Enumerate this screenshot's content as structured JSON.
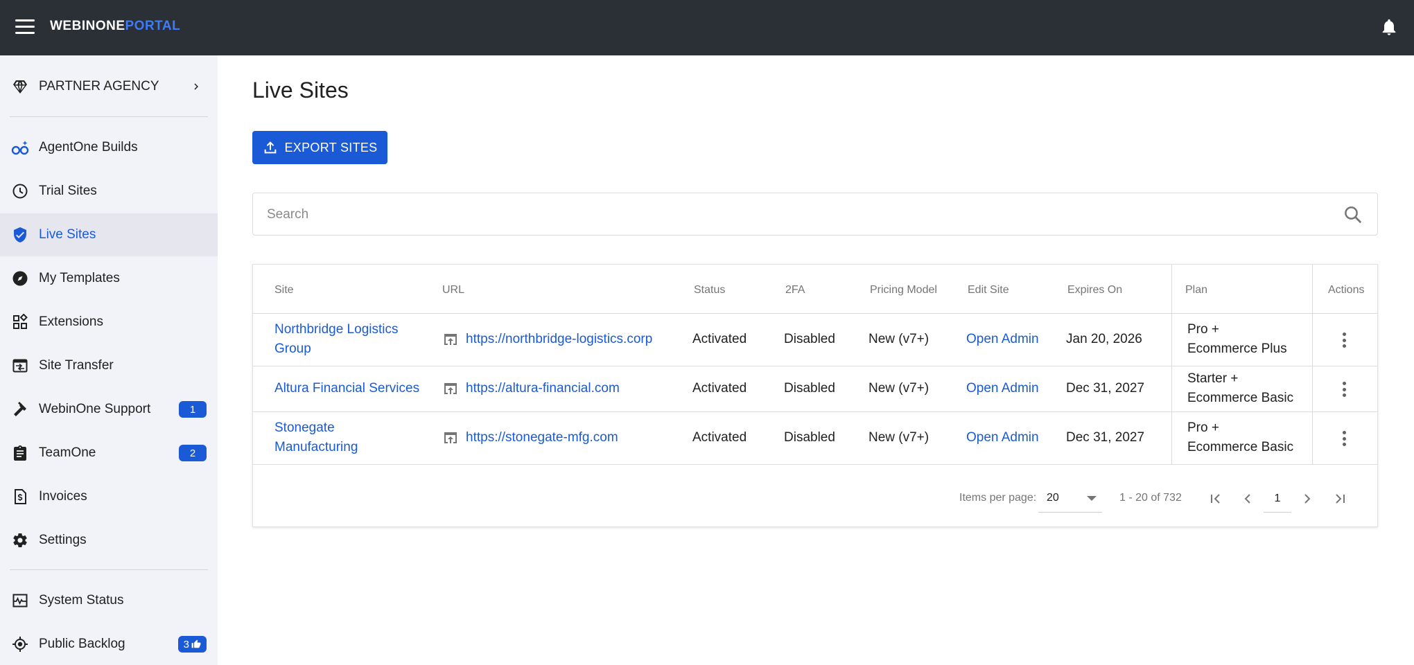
{
  "header": {
    "logo_part1": "WEBINONE",
    "logo_part2": "PORTAL",
    "bg_color": "#2b2f36",
    "accent_color": "#3e7bf6"
  },
  "sidebar": {
    "agency": "PARTNER AGENCY",
    "items": [
      {
        "label": "AgentOne Builds",
        "icon": "glasses-sparkle-icon"
      },
      {
        "label": "Trial Sites",
        "icon": "clock-icon"
      },
      {
        "label": "Live Sites",
        "icon": "shield-check-icon",
        "active": true
      },
      {
        "label": "My Templates",
        "icon": "compass-icon"
      },
      {
        "label": "Extensions",
        "icon": "extensions-icon"
      },
      {
        "label": "Site Transfer",
        "icon": "transfer-icon"
      },
      {
        "label": "WebinOne Support",
        "icon": "hammer-icon",
        "badge": "1"
      },
      {
        "label": "TeamOne",
        "icon": "clipboard-icon",
        "badge": "2"
      },
      {
        "label": "Invoices",
        "icon": "invoice-icon"
      },
      {
        "label": "Settings",
        "icon": "gear-icon"
      },
      {
        "label": "System Status",
        "icon": "pulse-icon"
      },
      {
        "label": "Public Backlog",
        "icon": "target-icon",
        "badge": "3"
      }
    ]
  },
  "main": {
    "title": "Live Sites",
    "export_label": "EXPORT SITES",
    "search_placeholder": "Search",
    "accent_color": "#1a5ad7"
  },
  "table": {
    "columns": [
      "Site",
      "URL",
      "Status",
      "2FA",
      "Pricing Model",
      "Edit Site",
      "Expires On",
      "Plan",
      "Actions"
    ],
    "rows": [
      {
        "site_line1": "Northbridge Logistics",
        "site_line2": "Group",
        "url": "https://northbridge-logistics.corp",
        "status": "Activated",
        "twofa": "Disabled",
        "pricing": "New (v7+)",
        "edit": "Open Admin",
        "expires": "Jan 20, 2026",
        "plan_line1": "Pro +",
        "plan_line2": "Ecommerce Plus"
      },
      {
        "site_line1": "Altura Financial Services",
        "site_line2": "",
        "url": "https://altura-financial.com",
        "status": "Activated",
        "twofa": "Disabled",
        "pricing": "New (v7+)",
        "edit": "Open Admin",
        "expires": "Dec 31, 2027",
        "plan_line1": "Starter +",
        "plan_line2": "Ecommerce Basic"
      },
      {
        "site_line1": "Stonegate",
        "site_line2": "Manufacturing",
        "url": "https://stonegate-mfg.com",
        "status": "Activated",
        "twofa": "Disabled",
        "pricing": "New (v7+)",
        "edit": "Open Admin",
        "expires": "Dec 31, 2027",
        "plan_line1": "Pro +",
        "plan_line2": "Ecommerce Basic"
      }
    ]
  },
  "pagination": {
    "items_per_page_label": "Items per page:",
    "items_per_page": "20",
    "range": "1 - 20 of 732",
    "page": "1"
  }
}
